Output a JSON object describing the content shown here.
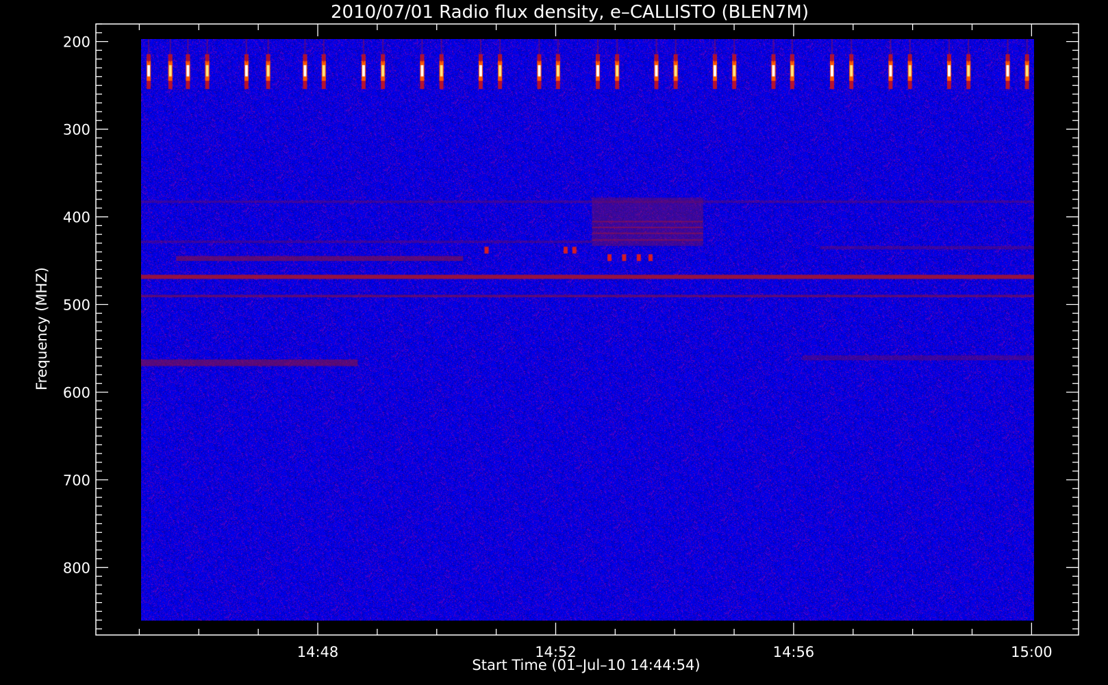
{
  "chart_data": {
    "type": "heatmap",
    "title": "2010/07/01  Radio flux density, e–CALLISTO (BLEN7M)",
    "xlabel": "Start Time (01–Jul–10 14:44:54)",
    "ylabel": "Frequency (MHZ)",
    "x_tick_labels": [
      "14:48",
      "14:52",
      "14:56",
      "15:00"
    ],
    "x_ticks_minutes": [
      228,
      232,
      236,
      240
    ],
    "xlim_minutes": [
      224.27,
      240.79
    ],
    "y_ticks": [
      200,
      300,
      400,
      500,
      600,
      700,
      800
    ],
    "ylim": [
      180,
      877
    ],
    "y_inverted": true,
    "data_range_minutes": [
      225.0,
      240.25
    ],
    "colormap": [
      "#0000dd",
      "#1a1acc",
      "#8a0a3a",
      "#cc1010",
      "#ff6000",
      "#ffe080",
      "#ffffff"
    ],
    "burst_band_mhz": [
      208,
      235
    ],
    "bursts_minutes": [
      225.13,
      225.5,
      225.8,
      226.13,
      226.8,
      227.17,
      227.8,
      228.12,
      228.8,
      229.13,
      229.8,
      230.13,
      230.8,
      231.13,
      231.8,
      232.12,
      232.8,
      233.13,
      233.8,
      234.13,
      234.8,
      235.13,
      235.8,
      236.12,
      236.8,
      237.13,
      237.8,
      238.13,
      238.8,
      239.13,
      239.8,
      240.13
    ],
    "horizontal_features": [
      {
        "freq_mhz": 465,
        "width_mhz": 5,
        "t_range": [
          225.0,
          240.25
        ],
        "level": 3
      },
      {
        "freq_mhz": 488,
        "width_mhz": 3,
        "t_range": [
          225.0,
          240.25
        ],
        "level": 2
      },
      {
        "freq_mhz": 443,
        "width_mhz": 6,
        "t_range": [
          225.6,
          230.5
        ],
        "level": 2
      },
      {
        "freq_mhz": 423,
        "width_mhz": 3,
        "t_range": [
          225.0,
          232.7
        ],
        "level": 1
      },
      {
        "freq_mhz": 568,
        "width_mhz": 8,
        "t_range": [
          225.0,
          228.7
        ],
        "level": 2
      },
      {
        "freq_mhz": 375,
        "width_mhz": 3,
        "t_range": [
          225.0,
          240.25
        ],
        "level": 1
      },
      {
        "freq_mhz": 430,
        "width_mhz": 4,
        "t_range": [
          236.6,
          240.25
        ],
        "level": 1
      },
      {
        "freq_mhz": 562,
        "width_mhz": 6,
        "t_range": [
          236.3,
          240.25
        ],
        "level": 1
      }
    ],
    "enhanced_block": {
      "t_range": [
        232.7,
        234.6
      ],
      "f_range": [
        370,
        428
      ],
      "level": 2
    },
    "spots": [
      {
        "t": 230.9,
        "f": 433
      },
      {
        "t": 232.25,
        "f": 433
      },
      {
        "t": 232.4,
        "f": 433
      },
      {
        "t": 233.0,
        "f": 442
      },
      {
        "t": 233.25,
        "f": 442
      },
      {
        "t": 233.5,
        "f": 442
      },
      {
        "t": 233.7,
        "f": 442
      }
    ]
  }
}
